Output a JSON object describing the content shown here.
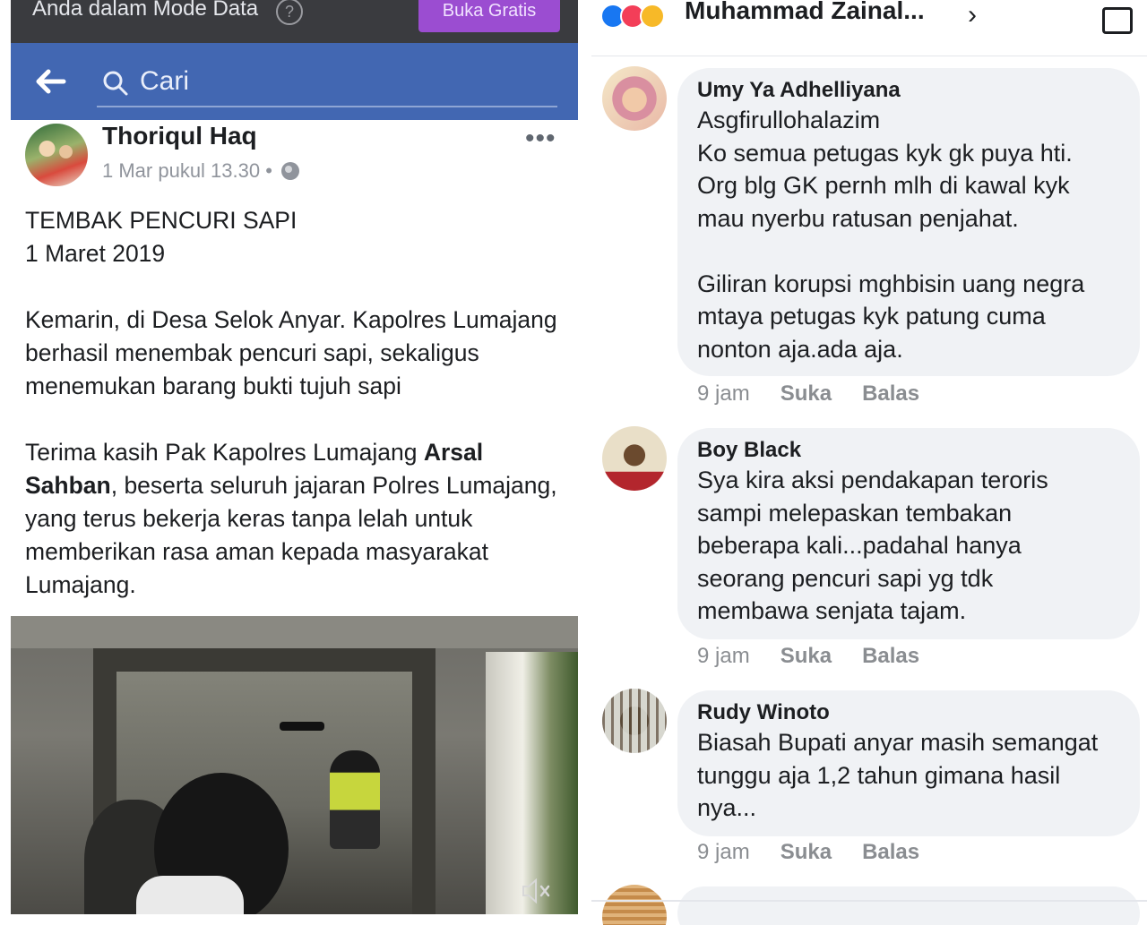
{
  "left": {
    "data_bar": {
      "text": "Anda dalam Mode Data",
      "help_icon": "?",
      "button": "Buka Gratis"
    },
    "header": {
      "search_placeholder": "Cari"
    },
    "post": {
      "author": "Thoriqul Haq",
      "timestamp": "1 Mar pukul 13.30 •",
      "more": "•••",
      "headline_1": "TEMBAK PENCURI SAPI",
      "headline_2": "1 Maret 2019",
      "para_1": "Kemarin, di Desa Selok Anyar. Kapolres Lumajang berhasil menembak pencuri sapi, sekaligus menemukan barang bukti tujuh sapi",
      "para_2_pre": "Terima kasih Pak Kapolres Lumajang ",
      "para_2_bold": "Arsal Sahban",
      "para_2_post": ", beserta seluruh jajaran Polres Lumajang, yang terus bekerja keras tanpa lelah untuk memberikan rasa aman kepada masyarakat Lumajang."
    },
    "video": {
      "mute_icon": "volume-muted-icon"
    }
  },
  "right": {
    "top": {
      "reactor": "Muhammad Zainal...",
      "chevron": "›"
    },
    "comments": [
      {
        "name": "Umy Ya Adhelliyana",
        "text": "Asgfirullohalazim\nKo semua petugas kyk gk puya hti.\nOrg blg GK pernh mlh di kawal kyk\nmau nyerbu ratusan penjahat.\n\nGiliran korupsi mghbisin uang negra\nmtaya petugas kyk patung cuma\nnonton aja.ada aja.",
        "time": "9 jam",
        "like": "Suka",
        "reply": "Balas"
      },
      {
        "name": "Boy Black",
        "text": "Sya kira  aksi pendakapan teroris\nsampi melepaskan tembakan\nbeberapa kali...padahal hanya\nseorang pencuri sapi yg tdk\nmembawa senjata tajam.",
        "time": "9 jam",
        "like": "Suka",
        "reply": "Balas"
      },
      {
        "name": "Rudy Winoto",
        "text": "Biasah Bupati anyar masih semangat\ntunggu aja 1,2 tahun gimana hasil\nnya...",
        "time": "9 jam",
        "like": "Suka",
        "reply": "Balas"
      }
    ]
  },
  "colors": {
    "fb_blue": "#4267b2",
    "data_bar": "#3a3b3f",
    "buka_button": "#9b4dd1",
    "bubble": "#f0f2f5",
    "meta_grey": "#90949c"
  }
}
